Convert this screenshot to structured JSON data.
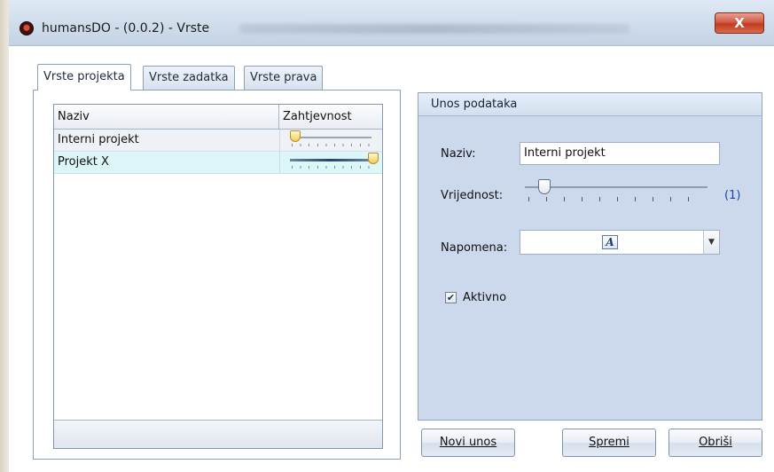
{
  "window": {
    "title": "humansDO - (0.0.2) - Vrste",
    "close_glyph": "X"
  },
  "tabs": [
    {
      "label": "Vrste projekta",
      "active": true
    },
    {
      "label": "Vrste zadatka",
      "active": false
    },
    {
      "label": "Vrste prava",
      "active": false
    }
  ],
  "grid": {
    "columns": [
      "Naziv",
      "Zahtjevnost"
    ],
    "rows": [
      {
        "naziv": "Interni projekt",
        "zahtjevnost": 1
      },
      {
        "naziv": "Projekt X",
        "zahtjevnost": 10
      }
    ],
    "slider_max": 10
  },
  "form": {
    "group_title": "Unos podataka",
    "naziv_label": "Naziv:",
    "naziv_value": "Interni projekt",
    "vrijednost_label": "Vrijednost:",
    "vrijednost_value": 1,
    "vrijednost_display": "(1)",
    "napomena_label": "Napomena:",
    "napomena_icon": "rich-text-editor-icon",
    "napomena_glyph": "A",
    "combo_arrow": "▼",
    "aktivno_label": "Aktivno",
    "aktivno_checked": true,
    "check_glyph": "✔"
  },
  "buttons": {
    "novi_unos": "Novi unos",
    "spremi": "Spremi",
    "obrisi": "Obriši"
  },
  "colors": {
    "selected_row": "#ddf6f7",
    "value_text": "#1a3fb3",
    "panel_bg": "#ccd9ec"
  }
}
